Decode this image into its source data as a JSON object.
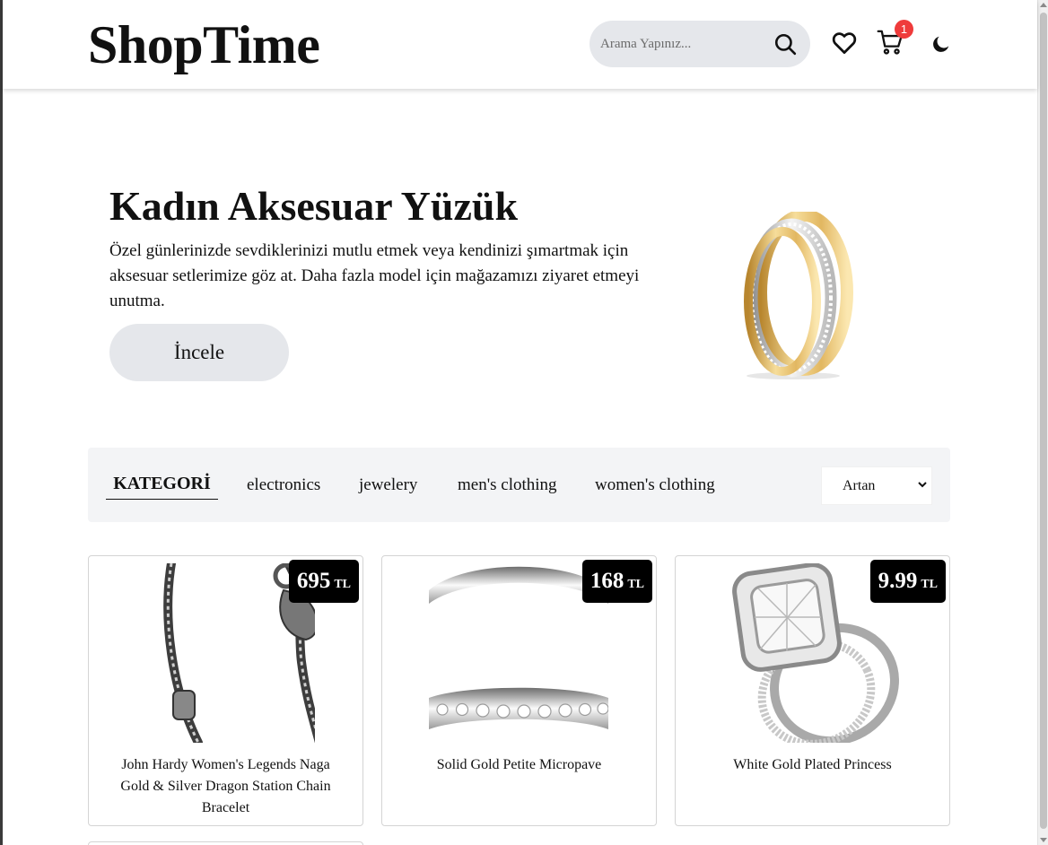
{
  "header": {
    "logo": "ShopTime",
    "search_placeholder": "Arama Yapınız...",
    "cart_count": "1"
  },
  "hero": {
    "title": "Kadın Aksesuar Yüzük",
    "text": "Özel günlerinizde sevdiklerinizi mutlu etmek veya kendinizi şımartmak için aksesuar setlerimize göz at. Daha fazla model için mağazamızı ziyaret etmeyi unutma.",
    "button": "İncele"
  },
  "categories": {
    "title": "KATEGORİ",
    "items": [
      "electronics",
      "jewelery",
      "men's clothing",
      "women's clothing"
    ],
    "sort": "Artan"
  },
  "products": [
    {
      "price": "695",
      "currency": "TL",
      "title": "John Hardy Women's Legends Naga Gold & Silver Dragon Station Chain Bracelet"
    },
    {
      "price": "168",
      "currency": "TL",
      "title": "Solid Gold Petite Micropave"
    },
    {
      "price": "9.99",
      "currency": "TL",
      "title": "White Gold Plated Princess"
    }
  ],
  "colors": {
    "accent": "#000000",
    "pill": "#e5e7eb",
    "badge": "#ef3b3b",
    "bar": "#f3f4f6"
  },
  "icons": [
    "search-icon",
    "heart-icon",
    "cart-icon",
    "moon-icon",
    "chevron-down-icon"
  ]
}
